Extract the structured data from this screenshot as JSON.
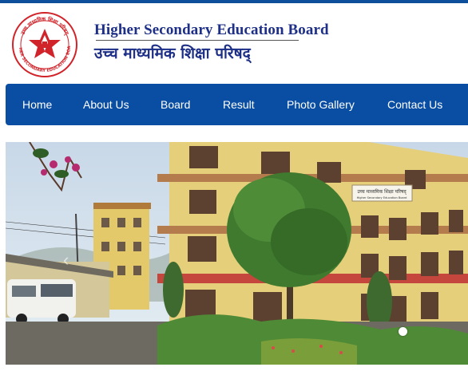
{
  "header": {
    "title_en": "Higher Secondary Education Board",
    "title_np": "उच्च माध्यमिक शिक्षा परिषद्",
    "logo_ring_text": "HIGHER SECONDARY EDUCATION BOARD",
    "logo_top_text": "उच्च माध्यमिक शिक्षा परिषद्"
  },
  "nav": {
    "items": [
      {
        "label": "Home"
      },
      {
        "label": "About Us"
      },
      {
        "label": "Board"
      },
      {
        "label": "Result"
      },
      {
        "label": "Photo Gallery"
      },
      {
        "label": "Contact Us"
      }
    ]
  },
  "slider": {
    "building_sign": "उच्च माध्यमिक शिक्षा परिषद्",
    "building_sign_en": "Higher Secondary Education Board",
    "prev_arrow": "‹",
    "active_slide": 1
  },
  "colors": {
    "brand_blue": "#0a4ea3",
    "title_blue": "#1d2f86",
    "logo_red": "#d1232a"
  }
}
